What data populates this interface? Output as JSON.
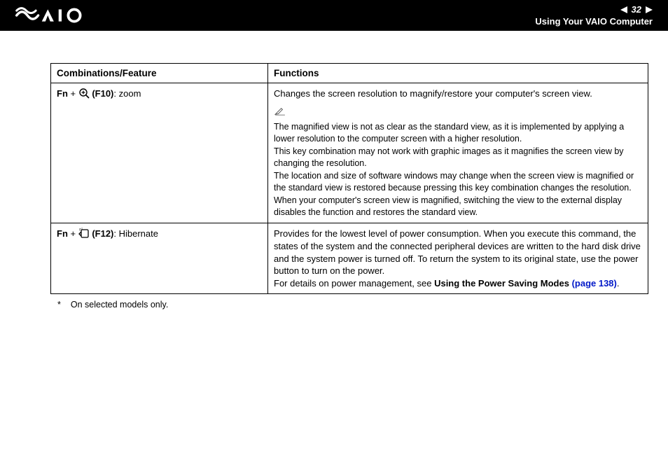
{
  "header": {
    "page_number": "32",
    "section": "Using Your VAIO Computer"
  },
  "table": {
    "headers": {
      "col1": "Combinations/Feature",
      "col2": "Functions"
    },
    "rows": [
      {
        "fn": "Fn",
        "plus": " + ",
        "key": " (F10)",
        "label": ": zoom",
        "icon": "magnify-icon",
        "func_main": "Changes the screen resolution to magnify/restore your computer's screen view.",
        "notes": [
          "The magnified view is not as clear as the standard view, as it is implemented by applying a lower resolution to the computer screen with a higher resolution.",
          "This key combination may not work with graphic images as it magnifies the screen view by changing the resolution.",
          "The location and size of software windows may change when the screen view is magnified or the standard view is restored because pressing this key combination changes the resolution.",
          "When your computer's screen view is magnified, switching the view to the external display disables the function and restores the standard view."
        ]
      },
      {
        "fn": "Fn",
        "plus": " + ",
        "key": " (F12)",
        "label": ": Hibernate",
        "icon": "hibernate-icon",
        "func_main": "Provides for the lowest level of power consumption. When you execute this command, the states of the system and the connected peripheral devices are written to the hard disk drive and the system power is turned off. To return the system to its original state, use the power button to turn on the power.",
        "detail_prefix": "For details on power management, see ",
        "detail_bold": "Using the Power Saving Modes ",
        "detail_link": "(page 138)",
        "detail_suffix": "."
      }
    ]
  },
  "footnote": {
    "mark": "*",
    "text": "On selected models only."
  }
}
